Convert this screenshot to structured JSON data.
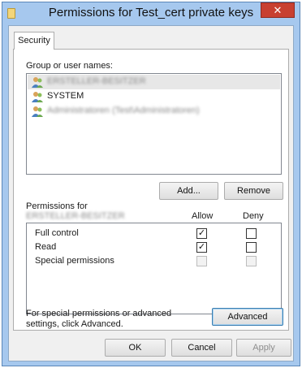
{
  "window": {
    "title": "Permissions for Test_cert private keys",
    "close_glyph": "✕"
  },
  "tabs": [
    {
      "label": "Security",
      "active": true
    }
  ],
  "group_section": {
    "label": "Group or user names:",
    "users": [
      {
        "name": "ERSTELLER-BESITZER",
        "icon": "users-icon",
        "obscured": true,
        "selected": true
      },
      {
        "name": "SYSTEM",
        "icon": "users-icon",
        "obscured": false,
        "selected": false
      },
      {
        "name": "Administratoren (Test\\Administratoren)",
        "icon": "users-icon",
        "obscured": true,
        "selected": false
      }
    ],
    "add_label": "Add...",
    "remove_label": "Remove"
  },
  "permissions": {
    "label": "Permissions for",
    "principal": "ERSTELLER-BESITZER",
    "allow_header": "Allow",
    "deny_header": "Deny",
    "rows": [
      {
        "label": "Full control",
        "allow": true,
        "deny": false,
        "enabled": true
      },
      {
        "label": "Read",
        "allow": true,
        "deny": false,
        "enabled": true
      },
      {
        "label": "Special permissions",
        "allow": false,
        "deny": false,
        "enabled": false
      }
    ]
  },
  "advanced": {
    "hint": "For special permissions or advanced settings, click Advanced.",
    "button_label": "Advanced"
  },
  "footer": {
    "ok_label": "OK",
    "cancel_label": "Cancel",
    "apply_label": "Apply"
  },
  "colors": {
    "title_bar": "#a6c8ee",
    "close_button": "#c84031",
    "dialog_background": "#f0f0f0",
    "selected_row": "#e7e7e7"
  }
}
